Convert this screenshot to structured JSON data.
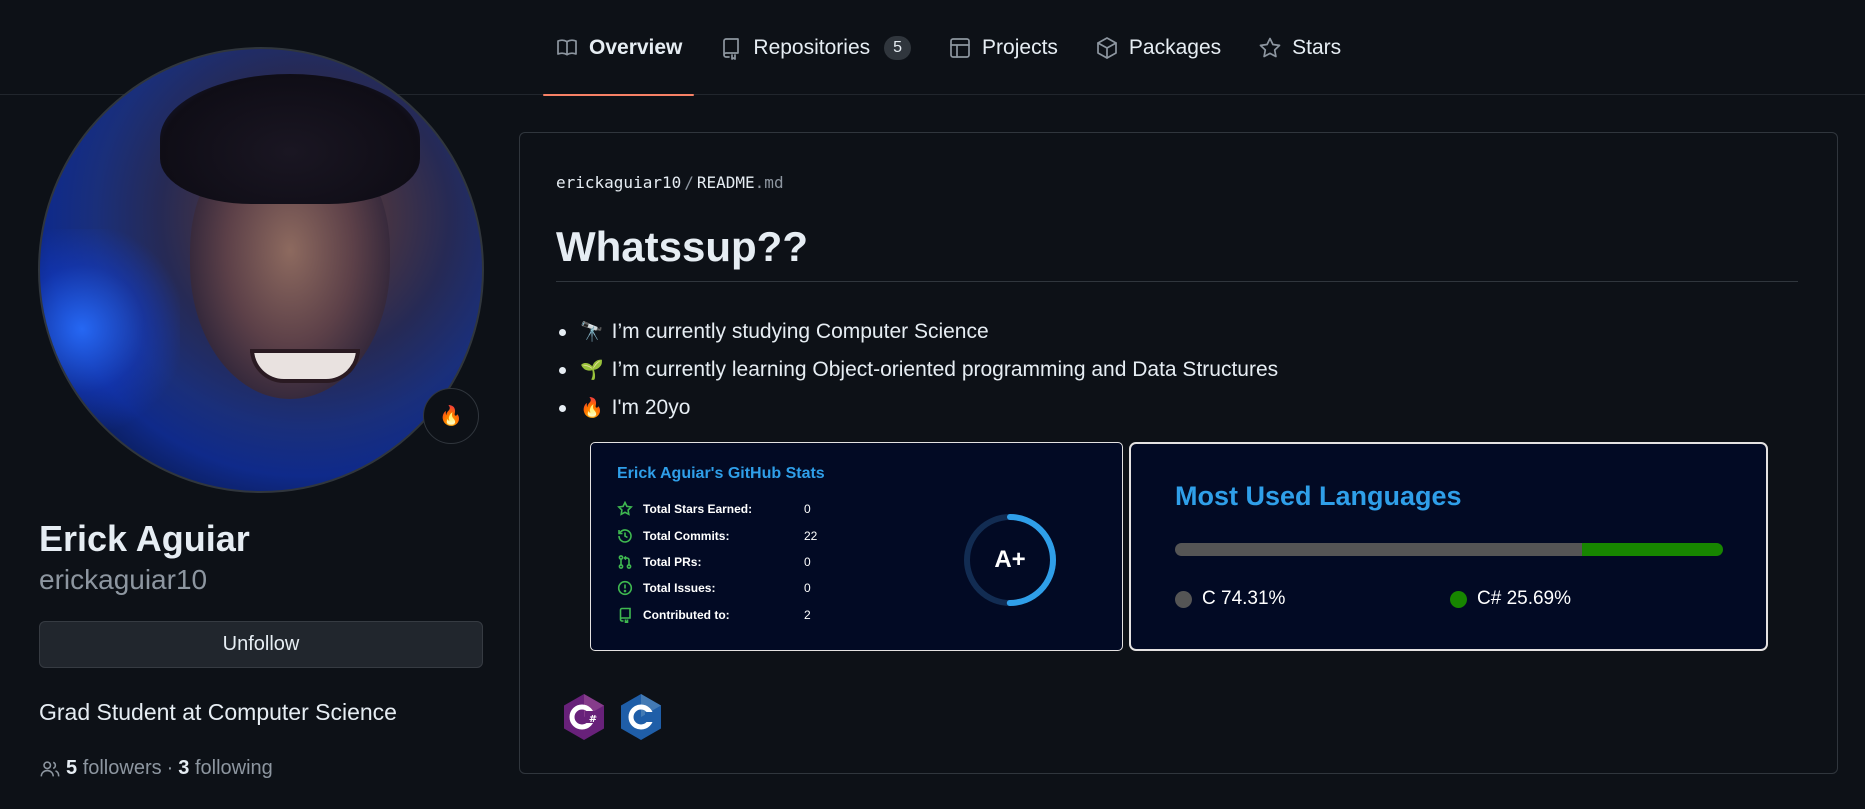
{
  "nav": {
    "tabs": [
      {
        "label": "Overview",
        "icon": "book-icon",
        "active": true
      },
      {
        "label": "Repositories",
        "icon": "repo-icon",
        "count": "5"
      },
      {
        "label": "Projects",
        "icon": "table-icon"
      },
      {
        "label": "Packages",
        "icon": "package-icon"
      },
      {
        "label": "Stars",
        "icon": "star-icon"
      }
    ]
  },
  "profile": {
    "status_emoji": "🔥",
    "full_name": "Erick Aguiar",
    "username": "erickaguiar10",
    "unfollow_label": "Unfollow",
    "bio": "Grad Student at Computer Science",
    "followers_count": "5",
    "followers_label": "followers",
    "separator": "·",
    "following_count": "3",
    "following_label": "following"
  },
  "readme": {
    "owner": "erickaguiar10",
    "sep": "/",
    "file_name": "README",
    "file_ext": ".md",
    "heading": "Whatssup??",
    "items": [
      {
        "emoji": "🔭",
        "text": "I’m currently studying Computer Science"
      },
      {
        "emoji": "🌱",
        "text": "I’m currently learning Object-oriented programming and Data Structures"
      },
      {
        "emoji": "🔥",
        "text": "I'm 20yo"
      }
    ]
  },
  "stats_card": {
    "title": "Erick Aguiar's GitHub Stats",
    "rows": [
      {
        "icon": "star-icon",
        "label": "Total Stars Earned:",
        "value": "0"
      },
      {
        "icon": "history-icon",
        "label": "Total Commits:",
        "value": "22"
      },
      {
        "icon": "pull-request-icon",
        "label": "Total PRs:",
        "value": "0"
      },
      {
        "icon": "issue-icon",
        "label": "Total Issues:",
        "value": "0"
      },
      {
        "icon": "repo-icon",
        "label": "Contributed to:",
        "value": "2"
      }
    ],
    "grade": "A+",
    "ring_progress": 0.5,
    "accent": "#2f9fe9"
  },
  "languages_card": {
    "title": "Most Used Languages",
    "languages": [
      {
        "name": "C",
        "percent_label": "74.31%",
        "percent": 74.31,
        "color": "#555555"
      },
      {
        "name": "C#",
        "percent_label": "25.69%",
        "percent": 25.69,
        "color": "#178600"
      }
    ]
  },
  "tech_icons": [
    {
      "name": "csharp-icon",
      "color": "#68217a"
    },
    {
      "name": "c-icon",
      "color": "#1f5ea8"
    }
  ]
}
